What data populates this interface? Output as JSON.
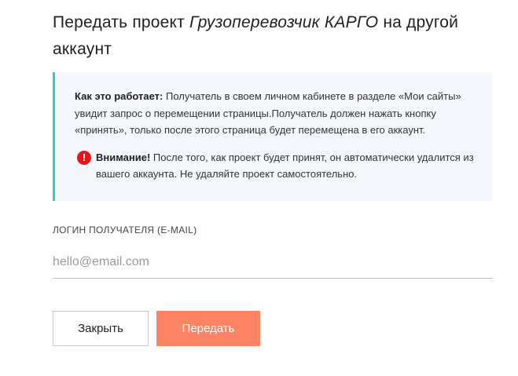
{
  "dialog": {
    "title_prefix": "Передать проект ",
    "project_name": "Грузоперевозчик КАРГО",
    "title_suffix": " на другой аккаунт"
  },
  "info": {
    "how_label": "Как это работает:",
    "how_text": " Получатель в своем личном кабинете в разделе «Мои сайты» увидит запрос о перемещении страницы.Получатель должен нажать кнопку «принять», только после этого страница будет перемещена в его аккаунт.",
    "warning_icon": "!",
    "warning_label": "Внимание!",
    "warning_text": " После того, как проект будет принят, он автоматически удалится из вашего аккаунта. Не удаляйте проект самостоятельно."
  },
  "form": {
    "login_label": "ЛОГИН ПОЛУЧАТЕЛЯ (E-MAIL)",
    "login_placeholder": "hello@email.com",
    "login_value": ""
  },
  "buttons": {
    "close_label": "Закрыть",
    "transfer_label": "Передать"
  },
  "colors": {
    "accent": "#fd8365",
    "info_border": "#3fc1dc",
    "info_background": "#f4f7fc",
    "warning": "#e8141b"
  },
  "icons": {
    "warning": "exclamation-circle-icon"
  }
}
